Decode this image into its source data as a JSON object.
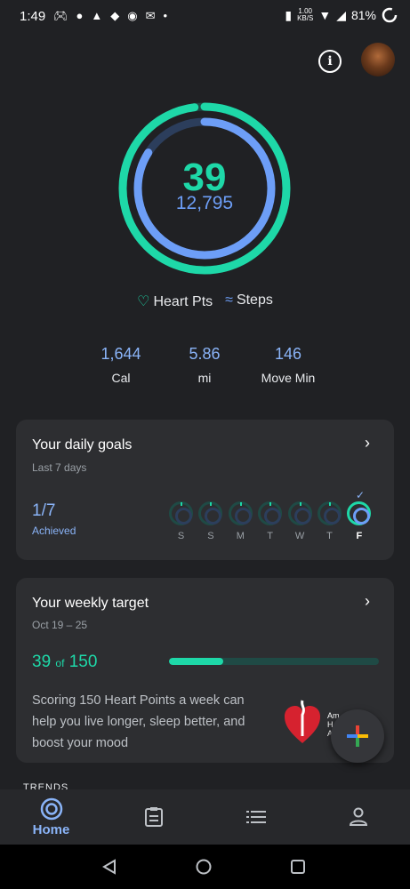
{
  "status_bar": {
    "time": "1:49",
    "notification_icons": [
      "discord-icon",
      "line-icon",
      "ghost-icon",
      "tinder-icon",
      "reddit-icon",
      "mail-icon",
      "dot-icon"
    ],
    "speed_value": "1.00",
    "speed_unit": "KB/S",
    "battery": "81%"
  },
  "header": {
    "info_icon": "info-icon",
    "avatar_icon": "avatar"
  },
  "rings": {
    "heart_points": "39",
    "steps": "12,795",
    "heart_points_goal_fraction": 0.98,
    "steps_goal_fraction": 0.84,
    "colors": {
      "heart": "#1ed8a8",
      "steps": "#6d9ef7",
      "heart_bg": "#1f4a45",
      "steps_bg": "#2c3e5c"
    }
  },
  "legend": {
    "heart_label": "Heart Pts",
    "steps_label": "Steps"
  },
  "stats": [
    {
      "value": "1,644",
      "label": "Cal"
    },
    {
      "value": "5.86",
      "label": "mi"
    },
    {
      "value": "146",
      "label": "Move Min"
    }
  ],
  "daily_goals": {
    "title": "Your daily goals",
    "subtitle": "Last 7 days",
    "achieved_count": "1/7",
    "achieved_label": "Achieved",
    "days": [
      {
        "label": "S",
        "achieved": false
      },
      {
        "label": "S",
        "achieved": false
      },
      {
        "label": "M",
        "achieved": false
      },
      {
        "label": "T",
        "achieved": false
      },
      {
        "label": "W",
        "achieved": false
      },
      {
        "label": "T",
        "achieved": false
      },
      {
        "label": "F",
        "achieved": true,
        "current": true
      }
    ]
  },
  "weekly_target": {
    "title": "Your weekly target",
    "date_range": "Oct 19 – 25",
    "current": "39",
    "of_label": "of",
    "target": "150",
    "progress_fraction": 0.26,
    "description": "Scoring 150 Heart Points a week can help you live longer, sleep better, and boost your mood",
    "partner_text": "Am\nH\nA"
  },
  "trends_label": "TRENDS",
  "bottom_nav": {
    "home_label": "Home",
    "items": [
      "home-icon",
      "journal-icon",
      "browse-icon",
      "profile-icon"
    ]
  }
}
